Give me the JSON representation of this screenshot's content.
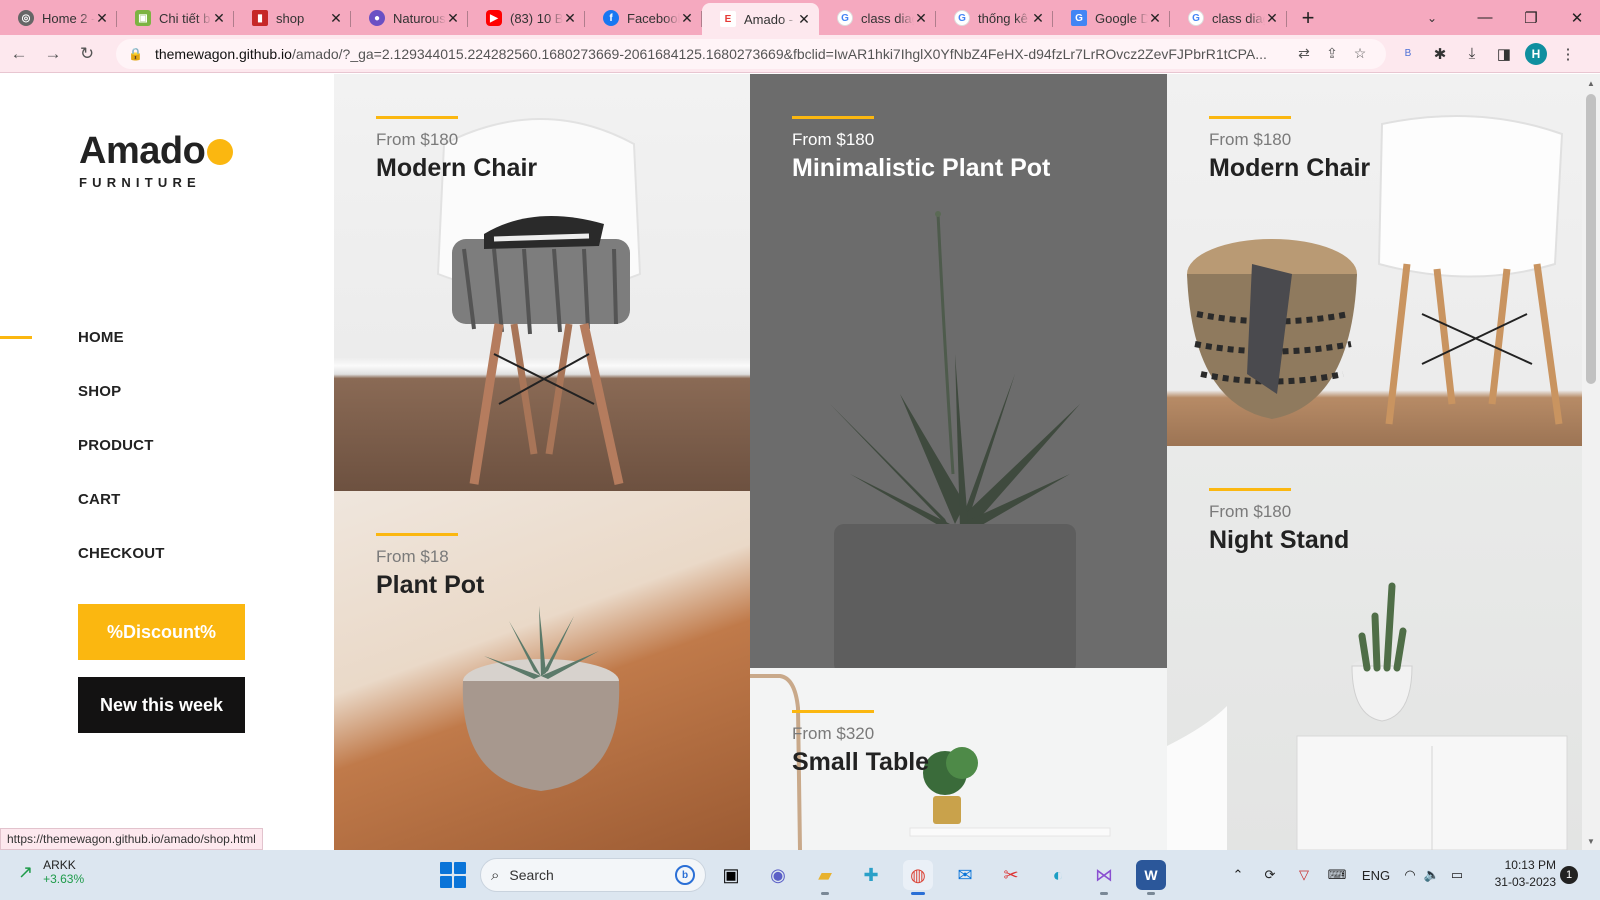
{
  "browser": {
    "tabs": [
      {
        "label": "Home 2 -",
        "icon": "globe-icon",
        "color": "#555555"
      },
      {
        "label": "Chi tiết b",
        "icon": "image-icon",
        "color": "#7cb342"
      },
      {
        "label": "shop",
        "icon": "shop-icon",
        "color": "#c62828"
      },
      {
        "label": "Naturous",
        "icon": "naturous-icon",
        "color": "#6a4fc4"
      },
      {
        "label": "(83) 10 B",
        "icon": "youtube-icon",
        "color": "#ff0000"
      },
      {
        "label": "Facebook",
        "icon": "facebook-icon",
        "color": "#1877f2"
      },
      {
        "label": "Amado -",
        "icon": "amado-icon",
        "color": "#e53935",
        "active": true
      },
      {
        "label": "class diag",
        "icon": "google-icon",
        "color": "#4285f4"
      },
      {
        "label": "thống kê",
        "icon": "google-icon",
        "color": "#4285f4"
      },
      {
        "label": "Google D",
        "icon": "google-translate-icon",
        "color": "#4285f4"
      },
      {
        "label": "class diag",
        "icon": "google-icon",
        "color": "#4285f4"
      }
    ],
    "new_tab": "+",
    "url_domain": "themewagon.github.io",
    "url_rest": "/amado/?_ga=2.129344015.224282560.1680273669-2061684125.1680273669&fbclid=IwAR1hki7IhglX0YfNbZ4FeHX-d94fzLr7LrROvcz2ZevFJPbrR1tCPA...",
    "profile_initial": "H",
    "status_url": "https://themewagon.github.io/amado/shop.html"
  },
  "site": {
    "logo": "Amado",
    "logo_sub": "FURNITURE",
    "menu": [
      "HOME",
      "SHOP",
      "PRODUCT",
      "CART",
      "CHECKOUT"
    ],
    "active_menu": "HOME",
    "discount_button": "%Discount%",
    "new_button": "New this week",
    "accent": "#fbb710"
  },
  "products": [
    {
      "price": "From $180",
      "name": "Modern Chair"
    },
    {
      "price": "From $180",
      "name": "Minimalistic Plant Pot"
    },
    {
      "price": "From $180",
      "name": "Modern Chair"
    },
    {
      "price": "From $18",
      "name": "Plant Pot"
    },
    {
      "price": "From $320",
      "name": "Small Table"
    },
    {
      "price": "From $180",
      "name": "Night Stand"
    }
  ],
  "taskbar": {
    "stock_name": "ARKK",
    "stock_change": "+3.63%",
    "search_placeholder": "Search",
    "language": "ENG",
    "time": "10:13 PM",
    "date": "31-03-2023",
    "notifications": "1"
  }
}
